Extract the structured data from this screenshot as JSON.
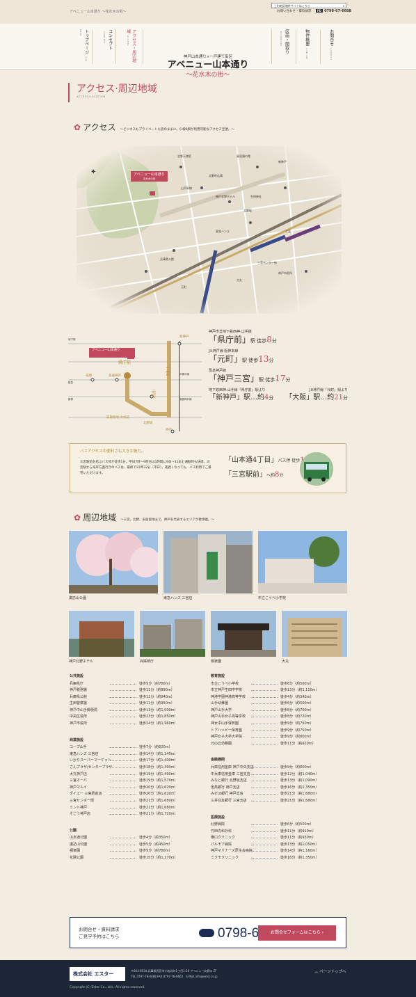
{
  "topbar": {
    "breadcrumb": "アベニュー山本通り ～花水木の街～",
    "site_select": "上町地区物件サイトはこちら",
    "contact": "お問い合わせ・資料請求",
    "tel": "0798-67-6688",
    "fd": "FD"
  },
  "nav_left": [
    {
      "label": "トップページ",
      "en": "TOP PAGE"
    },
    {
      "label": "コンセプト",
      "en": "CONCEPT"
    },
    {
      "label": "アクセス・周辺地域",
      "en": "ACCESS"
    }
  ],
  "nav_right": [
    {
      "label": "区画・間取り",
      "en": "ROOMPLAN"
    },
    {
      "label": "物件概要",
      "en": "OUTLINE"
    },
    {
      "label": "お問合せ",
      "en": "CONTACT"
    }
  ],
  "brand": {
    "sub": "神戸山本通り×一戸建て街区",
    "name": "アベニュー山本通り",
    "tag": "～花水木の街～"
  },
  "page_title": {
    "main": "アクセス·周辺地域",
    "en": "ACCESS/LOCATION"
  },
  "access": {
    "heading": "アクセス",
    "sub": "～ビジネスもプライベートも思のままに。6 線8駅が利用可能なアクセス至便。～"
  },
  "map": {
    "pin_title": "アベニュー山本通り",
    "pin_sub": "花水木の街",
    "labels": [
      "北野天満宮",
      "北野町広場",
      "風見鶏の館",
      "神戸北野ホテル",
      "北野坂",
      "山手幹線",
      "兵庫県公館",
      "東急ハンズ",
      "生田神社",
      "三宮",
      "元町",
      "神戸市役所",
      "大丸",
      "三宮センター街",
      "新神戸",
      "山本通",
      "神戸パナソニック",
      "みなと銀行",
      "神戸中央公園",
      "相楽園",
      "神戸電車"
    ]
  },
  "route": {
    "stations": [
      "新神戸",
      "県庁前",
      "三宮",
      "元町",
      "神戸",
      "旧居留地·大丸前",
      "花隈",
      "高速神戸",
      "北野坂"
    ],
    "lines": [
      "地下鉄",
      "阪急",
      "阪神",
      "JR神戸線",
      "阪急神戸線"
    ]
  },
  "access_list": [
    {
      "line": "神戸市営地下鉄西神·山手線",
      "station": "「県庁前」",
      "suffix": "駅 徒歩",
      "min": "8",
      "unit": "分"
    },
    {
      "line": "JR神戸線·阪神本線",
      "station": "「元町」",
      "suffix": "駅 徒歩",
      "min": "13",
      "unit": "分"
    },
    {
      "line": "阪急神戸線",
      "station": "「神戸三宮」",
      "suffix": "駅 徒歩",
      "min": "17",
      "unit": "分"
    }
  ],
  "far": {
    "l1": "地下鉄西神·山手線「県庁前」駅より",
    "l2": "JR神戸線「元町」駅より",
    "s1": "「新神戸」駅…約",
    "m1": "4",
    "s2": "「大阪」駅…約",
    "m2": "21",
    "unit": "分"
  },
  "bus": {
    "title": "バスアクセスの便利さも大きな魅力。",
    "desc": "三宮駅前を結ぶバス停が徒歩1分。平日7時～9時台は1時間に9本～11本と通勤時も快適。三宮駅から海岸方面行きのバスは、最終で22時32分（平日）。夜遅くなっても、バス利用でご帰宅いただけます。",
    "stop": "「山本通4丁目」",
    "stop_suffix": "バス停 徒歩",
    "stop_min": "1",
    "dest": "「三宮駅前」",
    "dest_suffix": "へ約",
    "dest_min": "8",
    "unit": "分"
  },
  "area": {
    "heading": "周辺地域",
    "sub": "～三宮、北野、旧居留地まで。神戸を代表するエリアが散歩圏。～"
  },
  "photos": [
    "諏訪山公園",
    "東急ハンズ 三宮店",
    "市立こうべ小学校",
    "神戸北野ホテル",
    "兵庫県庁",
    "相楽園",
    "大丸"
  ],
  "lists_left": [
    {
      "title": "公共施設",
      "items": [
        [
          "兵庫県庁",
          "徒歩9分（約780m）"
        ],
        [
          "神戸税務署",
          "徒歩11分（約890m）"
        ],
        [
          "兵庫県公館",
          "徒歩11分（約940m）"
        ],
        [
          "生田警察署",
          "徒歩11分（約950m）"
        ],
        [
          "神戸中山手郵便局",
          "徒歩13分（約1,000m）"
        ],
        [
          "中央区役所",
          "徒歩23分（約1,850m）"
        ],
        [
          "神戸市役所",
          "徒歩24分（約1,960m）"
        ]
      ]
    },
    {
      "title": "商業施設",
      "items": [
        [
          "コープ山手",
          "徒歩7分（約620m）"
        ],
        [
          "東急ハンズ 三宮店",
          "徒歩14分（約1,140m）"
        ],
        [
          "いかりスーパーマーケット",
          "徒歩17分（約1,400m）"
        ],
        [
          "さんプラザ/センタープラザ",
          "徒歩18分（約1,490m）"
        ],
        [
          "大丸神戸店",
          "徒歩19分（約1,490m）"
        ],
        [
          "三宮オーパ",
          "徒歩19分（約1,570m）"
        ],
        [
          "神戸マルイ",
          "徒歩20分（約1,620m）"
        ],
        [
          "ダイエー 三宮駅前店",
          "徒歩20分（約1,620m）"
        ],
        [
          "三宮センター街",
          "徒歩21分（約1,680m）"
        ],
        [
          "ミント神戸",
          "徒歩21分（約1,680m）"
        ],
        [
          "そごう神戸店",
          "徒歩21分（約1,720m）"
        ]
      ]
    },
    {
      "title": "公園",
      "items": [
        [
          "山本通公園",
          "徒歩4分（約350m）"
        ],
        [
          "諏訪山公園",
          "徒歩5分（約450m）"
        ],
        [
          "相楽園",
          "徒歩9分（約780m）"
        ],
        [
          "花隈公園",
          "徒歩15分（約1,270m）"
        ]
      ]
    }
  ],
  "lists_right": [
    {
      "title": "教育施設",
      "items": [
        [
          "市立こうべ小学校",
          "徒歩6分（約500m）"
        ],
        [
          "市立神戸生田中学校",
          "徒歩13分（約1,110m）"
        ],
        [
          "神港学園神港高等学校",
          "徒歩4分（約340m）"
        ],
        [
          "山手幼稚園",
          "徒歩6分（約500m）"
        ],
        [
          "神戸山手大学",
          "徒歩8分（約700m）"
        ],
        [
          "神戸山手女子高等学校",
          "徒歩8分（約720m）"
        ],
        [
          "神女中山手保育園",
          "徒歩9分（約750m）"
        ],
        [
          "トアハッピー保育園",
          "徒歩9分（約750m）"
        ],
        [
          "神戸女子大学大学院",
          "徒歩9分（約800m）"
        ],
        [
          "元の丘幼稚園",
          "徒歩11分（約920m）"
        ]
      ]
    },
    {
      "title": "金融機関",
      "items": [
        [
          "兵庫信用金庫 神戸中央支店",
          "徒歩9分（約800m）"
        ],
        [
          "中兵庫信用金庫 三宮支店",
          "徒歩12分（約1,040m）"
        ],
        [
          "みなと銀行 北野坂支店",
          "徒歩13分（約1,090m）"
        ],
        [
          "但馬銀行 神戸支店",
          "徒歩16分（約1,350m）"
        ],
        [
          "みずほ銀行 神戸支店",
          "徒歩21分（約1,680m）"
        ],
        [
          "三井住友銀行 三宮支店",
          "徒歩21分（約1,680m）"
        ]
      ]
    },
    {
      "title": "医療施設",
      "items": [
        [
          "北野病院",
          "徒歩6分（約500m）"
        ],
        [
          "竹田内科外科",
          "徒歩11分（約910m）"
        ],
        [
          "横口クリニック",
          "徒歩11分（約930m）"
        ],
        [
          "パルモア病院",
          "徒歩13分（約1,050m）"
        ],
        [
          "神戸マリナーズ厚生会病院",
          "徒歩14分（約1,160m）"
        ],
        [
          "ミクモクリニック",
          "徒歩16分（約1,350m）"
        ]
      ]
    }
  ],
  "cta": {
    "text1": "お問合せ・資料請求",
    "text2": "ご見学予約はこちら",
    "tel": "0798-67-6688",
    "button": "お問合せフォームはこちら ›"
  },
  "footer": {
    "logo": "株式会社 エスター",
    "address": "〒663-8034 兵庫県西宮市小松北町1丁目1-26 アベニュー北野口 2F",
    "tel": "TEL.0797-78-6688 FAX.0797-78-6663　E-Mail.info@ester.co.jp",
    "pagetop": "ページトップへ",
    "copyright": "Copyright (C) Ester Co., Ltd . All rights reserved."
  }
}
